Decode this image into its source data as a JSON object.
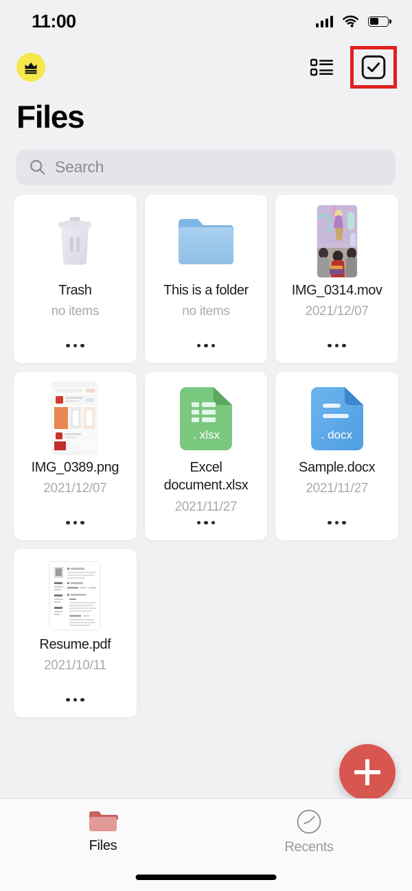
{
  "status_bar": {
    "time": "11:00",
    "cellular_icon": "cellular-signal-icon",
    "wifi_icon": "wifi-icon",
    "battery_icon": "battery-icon",
    "battery_level_percent": 50
  },
  "app_bar": {
    "premium_badge_icon": "crown-icon",
    "premium_badge_color": "#f7e74a",
    "list_view_icon": "list-view-icon",
    "select_mode_icon": "checkbox-check-icon",
    "highlight_color": "#e02020"
  },
  "header": {
    "title": "Files"
  },
  "search": {
    "icon": "search-icon",
    "placeholder": "Search",
    "value": ""
  },
  "files": [
    {
      "name": "Trash",
      "meta": "no items",
      "icon": "trash-icon",
      "kind": "trash",
      "more_icon": "more-options-icon"
    },
    {
      "name": "This is a folder",
      "meta": "no items",
      "icon": "folder-icon",
      "kind": "folder",
      "more_icon": "more-options-icon"
    },
    {
      "name": "IMG_0314.mov",
      "meta": "2021/12/07",
      "icon": "video-thumbnail",
      "kind": "video",
      "more_icon": "more-options-icon"
    },
    {
      "name": "IMG_0389.png",
      "meta": "2021/12/07",
      "icon": "image-thumbnail",
      "kind": "image",
      "more_icon": "more-options-icon"
    },
    {
      "name": "Excel document.xlsx",
      "meta": "2021/11/27",
      "icon": "xlsx-file-icon",
      "kind": "xlsx",
      "badge": ". xlsx",
      "color": "#7ac77f",
      "more_icon": "more-options-icon"
    },
    {
      "name": "Sample.docx",
      "meta": "2021/11/27",
      "icon": "docx-file-icon",
      "kind": "docx",
      "badge": ". docx",
      "color": "#5aa9ea",
      "more_icon": "more-options-icon"
    },
    {
      "name": "Resume.pdf",
      "meta": "2021/10/11",
      "icon": "pdf-thumbnail",
      "kind": "pdf",
      "more_icon": "more-options-icon"
    }
  ],
  "fab": {
    "icon": "plus-icon",
    "color": "#d7564f"
  },
  "tab_bar": {
    "items": [
      {
        "label": "Files",
        "icon": "folder-tab-icon",
        "active": true
      },
      {
        "label": "Recents",
        "icon": "clock-tab-icon",
        "active": false
      }
    ]
  }
}
